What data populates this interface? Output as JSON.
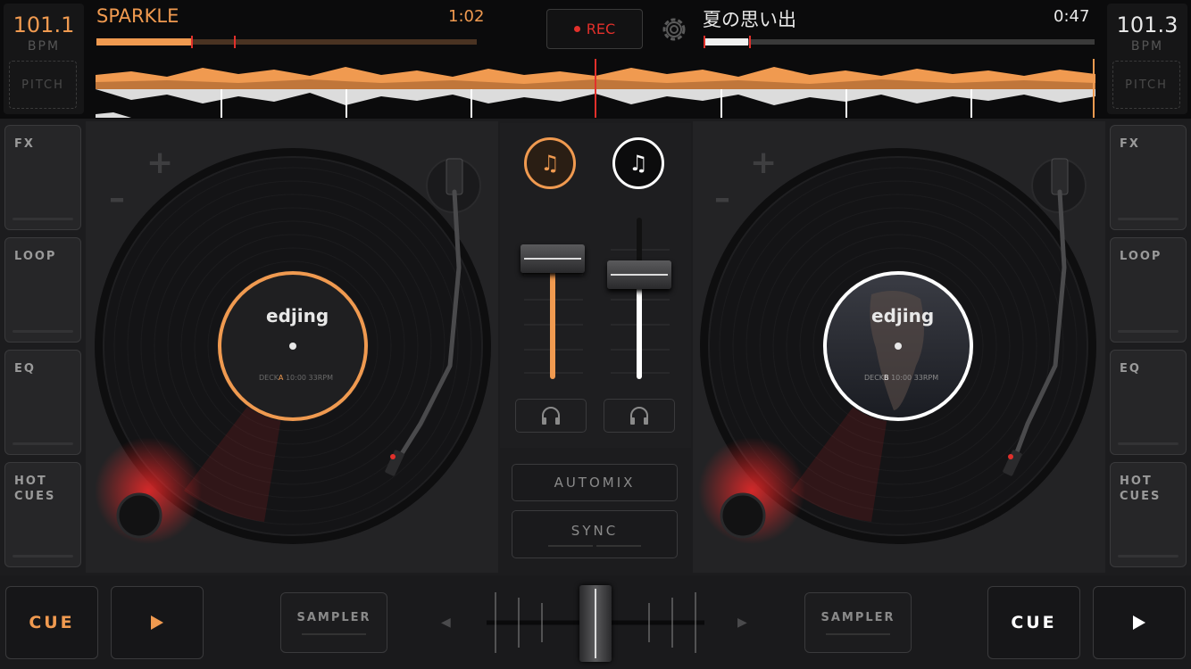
{
  "colors": {
    "deck_a": "#f09a50",
    "deck_b": "#ffffff",
    "rec": "#e2302b",
    "playhead": "#e2302b"
  },
  "deck_a": {
    "bpm": "101.1",
    "bpm_unit": "BPM",
    "pitch_label": "PITCH",
    "track_title": "SPARKLE",
    "time_remaining": "1:02",
    "label_brand": "edjing",
    "label_sub_prefix": "DECK",
    "label_sub_deck": "A",
    "label_sub_suffix": "10:00 33RPM",
    "add_song_icon": "music-note-plus-icon"
  },
  "deck_b": {
    "bpm": "101.3",
    "bpm_unit": "BPM",
    "pitch_label": "PITCH",
    "track_title": "夏の思い出",
    "time_remaining": "0:47",
    "label_brand": "edjing",
    "label_sub_prefix": "DECK",
    "label_sub_deck": "B",
    "label_sub_suffix": "10:00 33RPM",
    "add_song_icon": "music-note-plus-icon"
  },
  "header": {
    "rec_label": "REC",
    "settings_icon": "gear-icon"
  },
  "left_pads": [
    "FX",
    "LOOP",
    "EQ",
    "HOT\nCUES"
  ],
  "right_pads": [
    "FX",
    "LOOP",
    "EQ",
    "HOT\nCUES"
  ],
  "mixer": {
    "volume_a": 0.78,
    "volume_b": 0.66,
    "automix_label": "AUTOMIX",
    "sync_label": "SYNC",
    "crossfader": 0.5
  },
  "bottom": {
    "cue_a_label": "CUE",
    "cue_b_label": "CUE",
    "sampler_a_label": "SAMPLER",
    "sampler_b_label": "SAMPLER"
  }
}
